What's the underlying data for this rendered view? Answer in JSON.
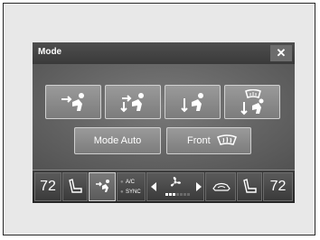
{
  "dialog": {
    "title": "Mode",
    "close_symbol": "✕"
  },
  "mode_buttons": [
    {
      "name": "face-vents",
      "icon": "face-vent-icon"
    },
    {
      "name": "face-and-floor-vents",
      "icon": "bilevel-vent-icon"
    },
    {
      "name": "floor-vents",
      "icon": "floor-vent-icon"
    },
    {
      "name": "floor-and-defrost",
      "icon": "floor-defrost-icon"
    }
  ],
  "mode_auto_label": "Mode Auto",
  "front_label": "Front",
  "climate_bar": {
    "left_temp": "72",
    "right_temp": "72",
    "ac_label": "A/C",
    "sync_label": "SYNC",
    "fan_level_filled": 3,
    "fan_level_total": 7
  },
  "colors": {
    "accent": "#ffffff",
    "indicator_off": "#6a6a6a"
  }
}
